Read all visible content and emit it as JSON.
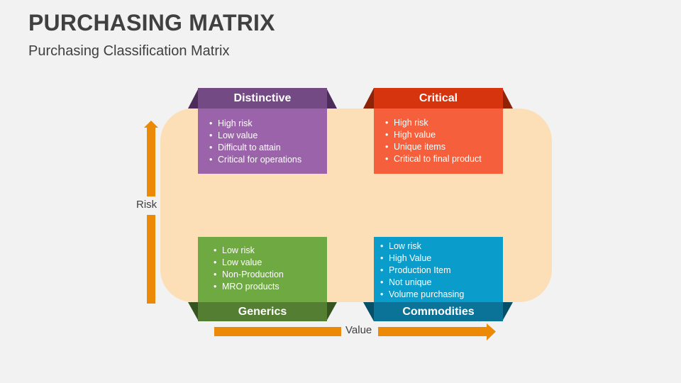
{
  "header": {
    "title": "PURCHASING MATRIX",
    "subtitle": "Purchasing Classification Matrix"
  },
  "axes": {
    "y_label": "Risk",
    "x_label": "Value",
    "arrow_color": "#ec8a07"
  },
  "quadrants": [
    {
      "id": "distinctive",
      "position": "top-left",
      "title": "Distinctive",
      "header_color": "#744a85",
      "body_color": "#9b64aa",
      "flap_color": "#4c2d5a",
      "items": [
        "High risk",
        "Low value",
        "Difficult to attain",
        "Critical for operations"
      ]
    },
    {
      "id": "critical",
      "position": "top-right",
      "title": "Critical",
      "header_color": "#d6330f",
      "body_color": "#f55f3b",
      "flap_color": "#8e2308",
      "items": [
        "High risk",
        "High value",
        "Unique items",
        "Critical to final product"
      ]
    },
    {
      "id": "generics",
      "position": "bottom-left",
      "title": "Generics",
      "header_color": "#547f33",
      "body_color": "#6ea942",
      "flap_color": "#36541f",
      "items": [
        "Low risk",
        "Low value",
        "Non-Production",
        "MRO products"
      ]
    },
    {
      "id": "commodities",
      "position": "bottom-right",
      "title": "Commodities",
      "header_color": "#0a7397",
      "body_color": "#0a9ccb",
      "flap_color": "#064f68",
      "items": [
        "Low risk",
        "High Value",
        "Production Item",
        "Not unique",
        "Volume purchasing"
      ]
    }
  ],
  "panel_color": "#fcdfb6"
}
